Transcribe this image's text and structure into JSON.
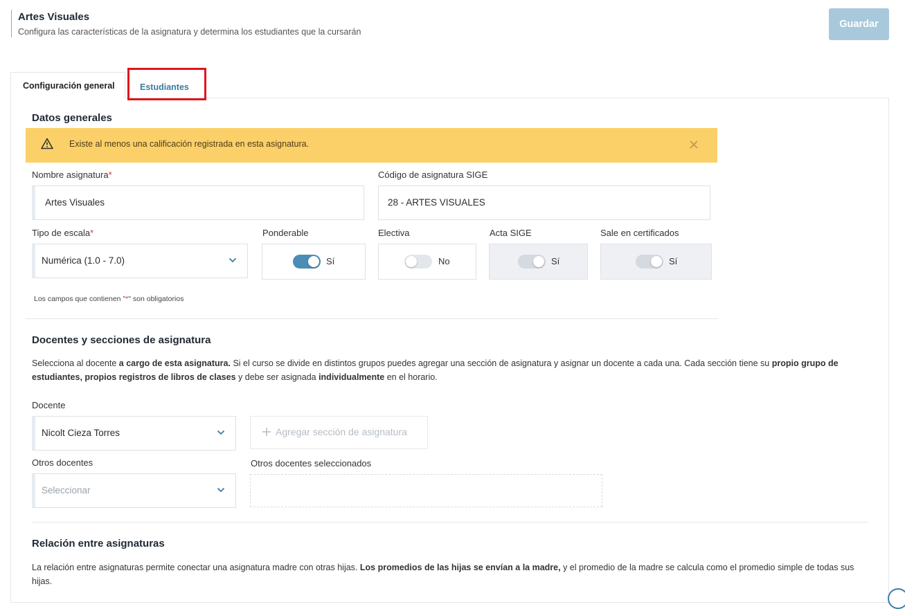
{
  "header": {
    "title": "Artes Visuales",
    "subtitle": "Configura las características de la asignatura y determina los estudiantes que la cursarán",
    "save_label": "Guardar"
  },
  "tabs": [
    {
      "label": "Configuración general",
      "active": true
    },
    {
      "label": "Estudiantes",
      "active": false
    }
  ],
  "general": {
    "title": "Datos generales",
    "alert": "Existe al menos una calificación registrada en esta asignatura.",
    "name_label": "Nombre asignatura",
    "name_value": "Artes Visuales",
    "sige_label": "Código de asignatura SIGE",
    "sige_value": "28 - ARTES VISUALES",
    "scale_label": "Tipo de escala",
    "scale_value": "Numérica (1.0 - 7.0)",
    "toggles": [
      {
        "label": "Ponderable",
        "state": "Sí",
        "on": true,
        "disabled": false
      },
      {
        "label": "Electiva",
        "state": "No",
        "on": false,
        "disabled": false
      },
      {
        "label": "Acta SIGE",
        "state": "Sí",
        "on": true,
        "disabled": true
      },
      {
        "label": "Sale en certificados",
        "state": "Sí",
        "on": true,
        "disabled": true
      }
    ],
    "required_note_pre": "Los campos que contienen \"",
    "required_note_star": "*",
    "required_note_post": "\" son obligatorios",
    "required_mark": "*"
  },
  "teachers": {
    "title": "Docentes y secciones de asignatura",
    "desc_1": "Selecciona al docente ",
    "desc_2": "a cargo de esta asignatura.",
    "desc_3": " Si el curso se divide en distintos grupos puedes agregar una sección de asignatura y asignar un docente a cada una. Cada sección tiene su ",
    "desc_4": "propio grupo de estudiantes, propios registros de libros de clases",
    "desc_5": " y debe ser asignada ",
    "desc_6": "individualmente",
    "desc_7": " en el horario.",
    "teacher_label": "Docente",
    "teacher_value": "Nicolt Cieza Torres",
    "add_section_label": "Agregar sección de asignatura",
    "others_label": "Otros docentes",
    "others_placeholder": "Seleccionar",
    "others_selected_label": "Otros docentes seleccionados"
  },
  "relation": {
    "title": "Relación entre asignaturas",
    "desc_1": "La relación entre asignaturas permite conectar una asignatura madre con otras hijas. ",
    "desc_2": "Los promedios de las hijas se envían a la madre,",
    "desc_3": " y el promedio de la madre se calcula como el promedio simple de todas sus hijas."
  },
  "colors": {
    "accent": "#4a8db5",
    "alert_bg": "#fbd068",
    "save_disabled": "#a8c9dc",
    "highlight": "#e0141b"
  }
}
